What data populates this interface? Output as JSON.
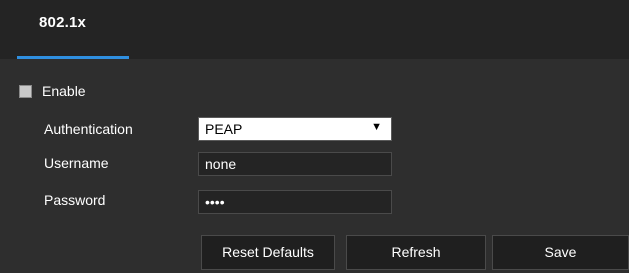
{
  "tabs": [
    {
      "label": "802.1x",
      "active": true
    }
  ],
  "form": {
    "enable": {
      "label": "Enable",
      "checked": false
    },
    "authentication": {
      "label": "Authentication",
      "value": "PEAP"
    },
    "username": {
      "label": "Username",
      "value": "none"
    },
    "password": {
      "label": "Password",
      "value": "••••"
    }
  },
  "buttons": {
    "reset_defaults": "Reset Defaults",
    "refresh": "Refresh",
    "save": "Save"
  },
  "colors": {
    "accent": "#2f8fe0",
    "background": "#2e2e2e",
    "tabbar": "#242424"
  },
  "icons": {
    "dropdown": "triangle-down-icon"
  }
}
